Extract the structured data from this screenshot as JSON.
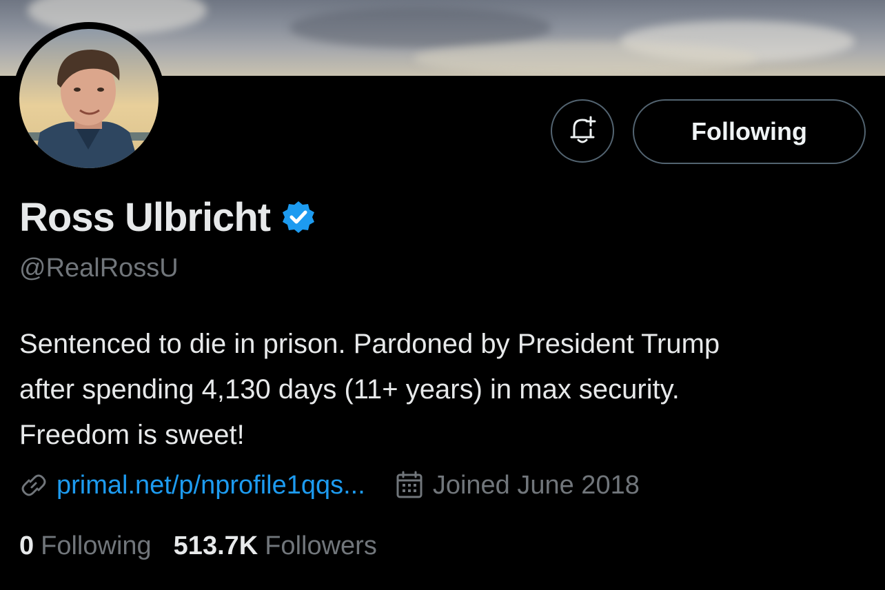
{
  "profile": {
    "name": "Ross Ulbricht",
    "handle": "@RealRossU",
    "bio_lines": [
      "Sentenced to die in prison. Pardoned by President Trump",
      "after spending 4,130 days (11+ years) in max security.",
      "Freedom is sweet!"
    ],
    "link": "primal.net/p/nprofile1qqs...",
    "joined": "Joined June 2018"
  },
  "actions": {
    "follow_label": "Following"
  },
  "stats": {
    "following_count": "0",
    "following_label": "Following",
    "followers_count": "513.7K",
    "followers_label": "Followers"
  },
  "icons": {
    "notify": "bell-plus-icon",
    "verified": "verified-badge-icon",
    "link": "link-icon",
    "calendar": "calendar-icon"
  },
  "colors": {
    "background": "#000000",
    "text": "#e7e9ea",
    "muted": "#71767b",
    "accent": "#1d9bf0",
    "border": "#536471"
  }
}
